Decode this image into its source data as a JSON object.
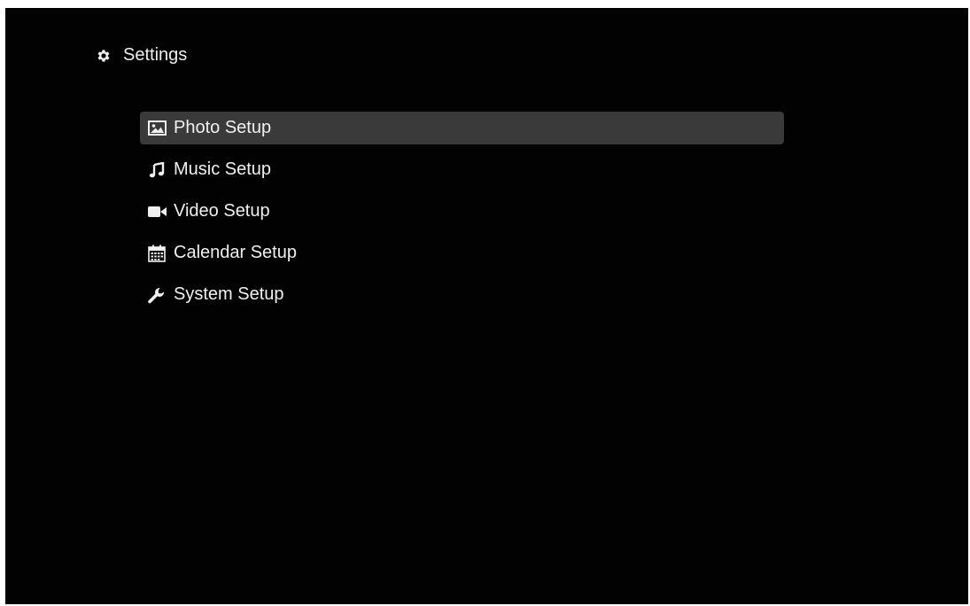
{
  "header": {
    "title": "Settings",
    "icon": "gear-icon"
  },
  "menu": {
    "selected_index": 0,
    "items": [
      {
        "label": "Photo Setup",
        "icon": "photo-icon"
      },
      {
        "label": "Music Setup",
        "icon": "music-note-icon"
      },
      {
        "label": "Video Setup",
        "icon": "video-camera-icon"
      },
      {
        "label": "Calendar Setup",
        "icon": "calendar-icon"
      },
      {
        "label": "System Setup",
        "icon": "wrench-icon"
      }
    ]
  },
  "colors": {
    "background": "#020202",
    "selection": "#3a3a3a",
    "text": "#f0f0f0"
  }
}
